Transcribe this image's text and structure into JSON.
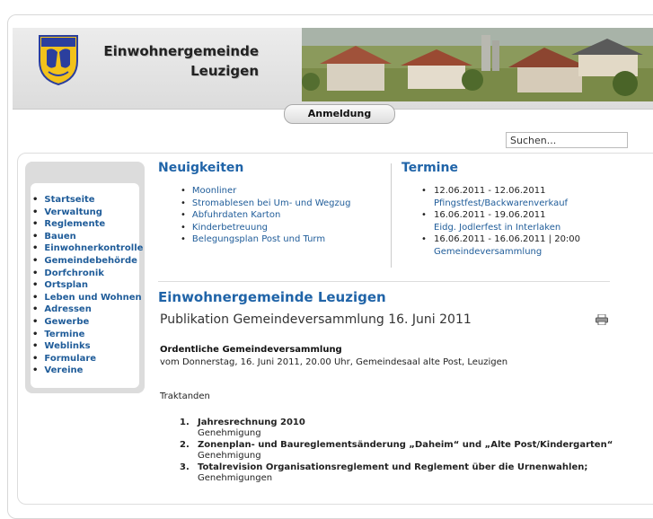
{
  "site": {
    "title_line1": "Einwohnergemeinde",
    "title_line2": "Leuzigen",
    "login_tab": "Anmeldung"
  },
  "search": {
    "value": "Suchen..."
  },
  "nav": {
    "items": [
      "Startseite",
      "Verwaltung",
      "Reglemente",
      "Bauen",
      "Einwohnerkontrolle",
      "Gemeindebehörde",
      "Dorfchronik",
      "Ortsplan",
      "Leben und Wohnen",
      "Adressen",
      "Gewerbe",
      "Termine",
      "Weblinks",
      "Formulare",
      "Vereine"
    ]
  },
  "news": {
    "title": "Neuigkeiten",
    "items": [
      "Moonliner",
      "Stromablesen bei Um- und Wegzug",
      "Abfuhrdaten Karton",
      "Kinderbetreuung",
      "Belegungsplan Post und Turm"
    ]
  },
  "events": {
    "title": "Termine",
    "items": [
      {
        "date": "12.06.2011 - 12.06.2011",
        "name": "Pfingstfest/Backwarenverkauf"
      },
      {
        "date": "16.06.2011 - 19.06.2011",
        "name": "Eidg. Jodlerfest in Interlaken"
      },
      {
        "date": "16.06.2011 - 16.06.2011 | 20:00",
        "name": "Gemeindeversammlung"
      }
    ]
  },
  "main": {
    "heading": "Einwohnergemeinde Leuzigen",
    "article_title": "Publikation Gemeindeversammlung 16. Juni 2011",
    "bold_line": "Ordentliche Gemeindeversammlung",
    "line": "vom Donnerstag, 16. Juni 2011, 20.00 Uhr, Gemeindesaal alte Post, Leuzigen",
    "traktanden": "Traktanden",
    "agenda": [
      {
        "num": "1.",
        "title": "Jahresrechnung 2010",
        "sub": "Genehmigung"
      },
      {
        "num": "2.",
        "title": "Zonenplan- und Baureglementsänderung „Daheim“ und „Alte Post/Kindergarten“",
        "sub": "Genehmigung"
      },
      {
        "num": "3.",
        "title": "Totalrevision Organisationsreglement und Reglement über die Urnenwahlen;",
        "sub": "Genehmigungen"
      }
    ]
  },
  "colors": {
    "link": "#1f5c99",
    "heading": "#2064a8"
  }
}
